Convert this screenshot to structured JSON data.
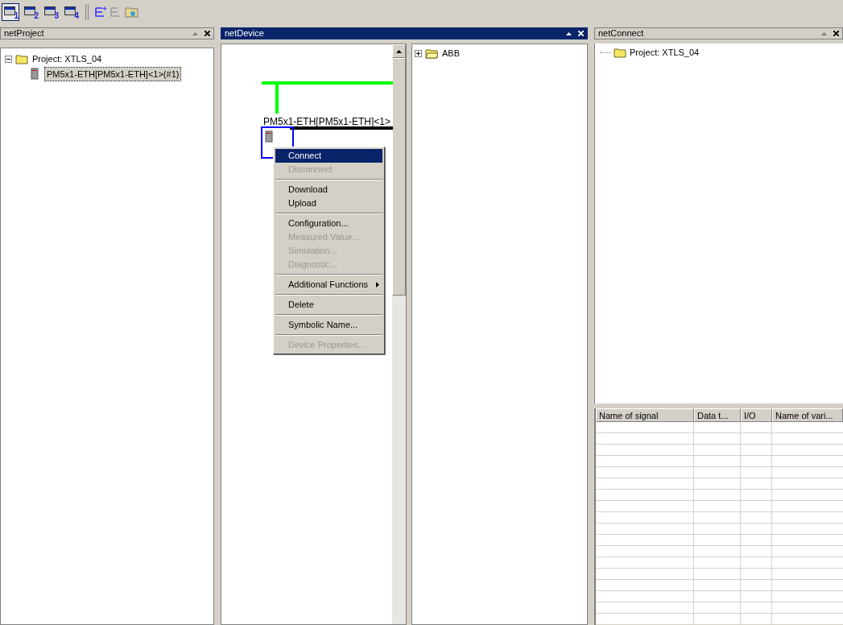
{
  "toolbar": {
    "window_buttons": [
      {
        "label": "1",
        "selected": true
      },
      {
        "label": "2",
        "selected": false
      },
      {
        "label": "3",
        "selected": false
      },
      {
        "label": "4",
        "selected": false
      }
    ]
  },
  "project_panel": {
    "title": "netProject",
    "tree": [
      {
        "label": "Project: XTLS_04",
        "expanded": true,
        "children": [
          {
            "label": "PM5x1-ETH[PM5x1-ETH]<1>(#1)",
            "selected": true
          }
        ]
      }
    ]
  },
  "device_panel": {
    "title": "netDevice",
    "device_label": "PM5x1-ETH[PM5x1-ETH]<1>",
    "catalog": [
      {
        "label": "ABB",
        "expanded": false
      }
    ]
  },
  "context_menu": [
    {
      "kind": "item",
      "label": "Connect",
      "selected": true,
      "disabled": false
    },
    {
      "kind": "item",
      "label": "Disconnect",
      "selected": false,
      "disabled": true
    },
    {
      "kind": "separator"
    },
    {
      "kind": "item",
      "label": "Download",
      "selected": false,
      "disabled": false
    },
    {
      "kind": "item",
      "label": "Upload",
      "selected": false,
      "disabled": false
    },
    {
      "kind": "separator"
    },
    {
      "kind": "item",
      "label": "Configuration...",
      "selected": false,
      "disabled": false
    },
    {
      "kind": "item",
      "label": "Measured Value...",
      "selected": false,
      "disabled": true
    },
    {
      "kind": "item",
      "label": "Simulation...",
      "selected": false,
      "disabled": true
    },
    {
      "kind": "item",
      "label": "Diagnostic...",
      "selected": false,
      "disabled": true
    },
    {
      "kind": "separator"
    },
    {
      "kind": "submenu",
      "label": "Additional Functions",
      "selected": false,
      "disabled": false
    },
    {
      "kind": "separator"
    },
    {
      "kind": "item",
      "label": "Delete",
      "selected": false,
      "disabled": false
    },
    {
      "kind": "separator"
    },
    {
      "kind": "item",
      "label": "Symbolic Name...",
      "selected": false,
      "disabled": false
    },
    {
      "kind": "separator"
    },
    {
      "kind": "item",
      "label": "Device Properties...",
      "selected": false,
      "disabled": true
    }
  ],
  "connect_panel": {
    "title": "netConnect",
    "tree": [
      {
        "label": "Project: XTLS_04"
      }
    ],
    "table": {
      "columns": [
        "Name of signal",
        "Data t...",
        "I/O",
        "Name of vari..."
      ]
    }
  }
}
